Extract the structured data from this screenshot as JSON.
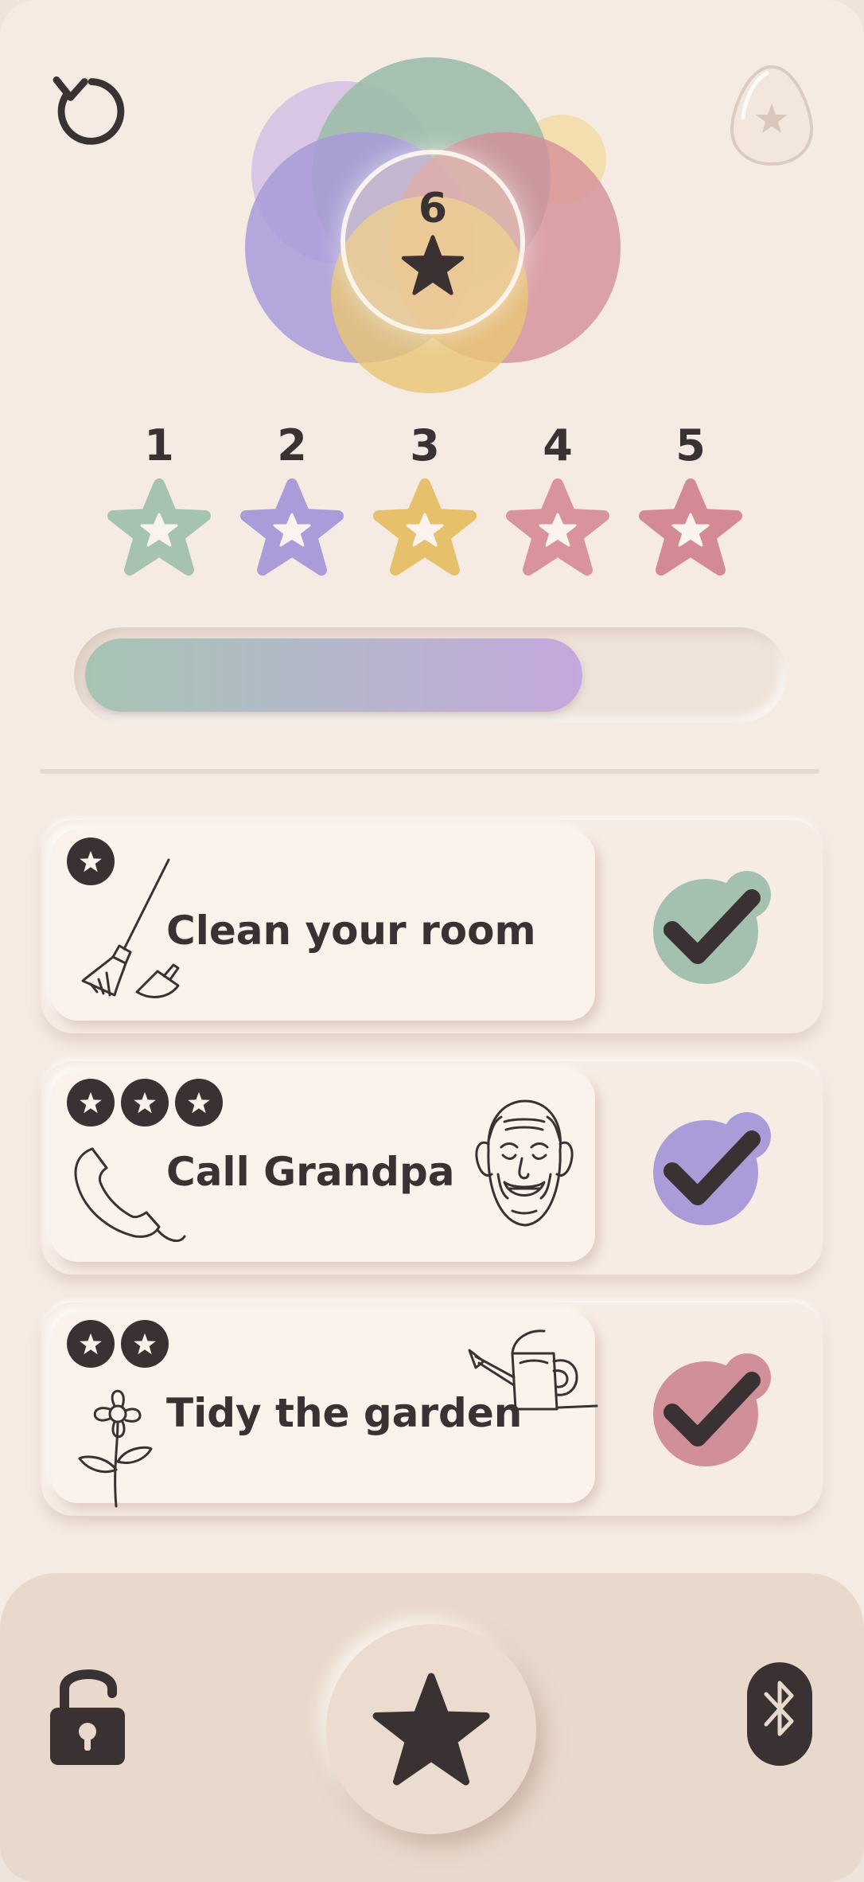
{
  "header": {
    "reset_icon": "refresh-icon",
    "egg_icon": "egg-star-icon"
  },
  "summary": {
    "total_stars": "6",
    "colors": {
      "green": "#9dbca8",
      "purple": "#a99ad9",
      "yellow": "#e8c572",
      "pink": "#d48f98",
      "lavender": "#cdb9e4",
      "light_yellow": "#f1d99d"
    }
  },
  "levels": [
    {
      "label": "1",
      "color": "#a6c3b0"
    },
    {
      "label": "2",
      "color": "#ab9cd9"
    },
    {
      "label": "3",
      "color": "#e6c06a"
    },
    {
      "label": "4",
      "color": "#d9939d"
    },
    {
      "label": "5",
      "color": "#d48a94"
    }
  ],
  "progress": {
    "fraction": 0.72
  },
  "tasks": [
    {
      "title": "Clean your room",
      "stars": 1,
      "check_color": "#a3c1ae",
      "icon": "broom-dustpan-icon"
    },
    {
      "title": "Call Grandpa",
      "stars": 3,
      "check_color": "#ab9cd9",
      "icon": "phone-grandpa-icon"
    },
    {
      "title": "Tidy the garden",
      "stars": 2,
      "check_color": "#d18f99",
      "icon": "flower-watering-can-icon"
    }
  ],
  "bottom": {
    "lock_icon": "unlock-icon",
    "fab_icon": "star-icon",
    "bluetooth_icon": "bluetooth-icon"
  }
}
